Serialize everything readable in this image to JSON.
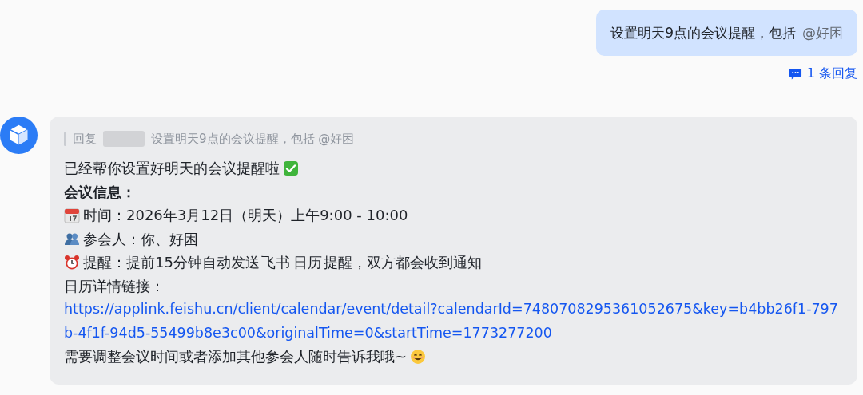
{
  "user_message": {
    "text": "设置明天9点的会议提醒，包括",
    "mention": "@好困"
  },
  "reply_count": "1 条回复",
  "bot_reply": {
    "quote": {
      "label": "回复",
      "text": "设置明天9点的会议提醒，包括 @好困"
    },
    "lines": [
      {
        "kind": "done",
        "text": "已经帮你设置好明天的会议提醒啦"
      },
      {
        "kind": "heading",
        "text": "会议信息："
      },
      {
        "kind": "time",
        "text": "时间：2026年3月12日（明天）上午9:00 - 10:00"
      },
      {
        "kind": "attendees",
        "text": "参会人：你、好困"
      },
      {
        "kind": "reminder",
        "parts": [
          {
            "text": "提醒：提前15分钟自动发送",
            "underlined": false
          },
          {
            "text": "飞书",
            "underlined": true
          },
          {
            "text": "日历",
            "underlined": true
          },
          {
            "text": "提醒，双方都会收到通知",
            "underlined": false
          }
        ]
      },
      {
        "kind": "plain",
        "text": "日历详情链接："
      },
      {
        "kind": "link",
        "text": "https://applink.feishu.cn/client/calendar/event/detail?calendarId=7480708295361052675&key=b4bb26f1-797b-4f1f-94d5-55499b8e3c00&originalTime=0&startTime=1773277200"
      },
      {
        "kind": "closing",
        "text": "需要调整会议时间或者添加其他参会人随时告诉我哦~"
      }
    ]
  }
}
